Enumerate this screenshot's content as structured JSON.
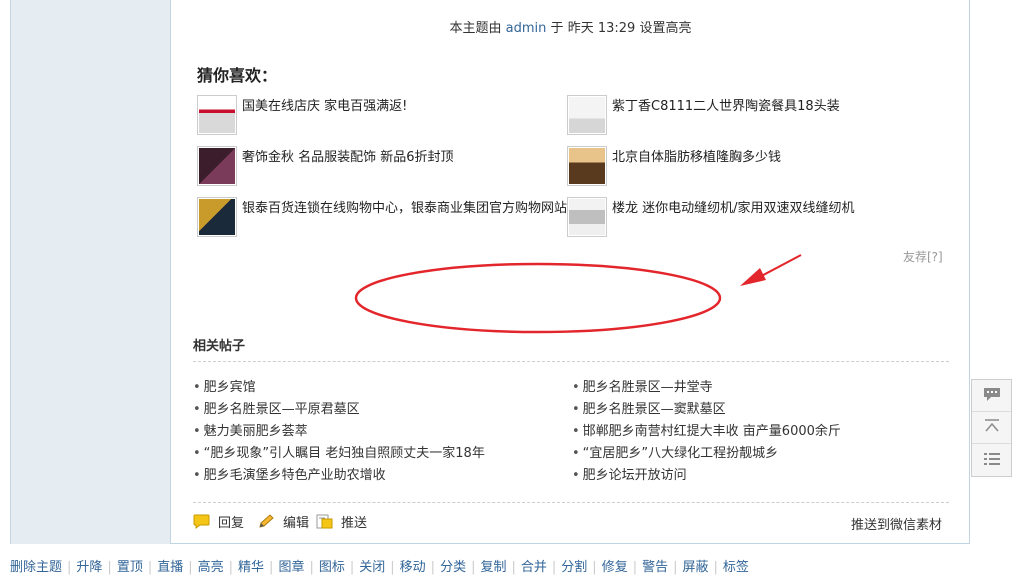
{
  "highlight_note": {
    "prefix": "本主题由",
    "user": "admin",
    "middle": "于",
    "time": "昨天 13:29",
    "suffix": "设置高亮"
  },
  "recommend": {
    "title": "猜你喜欢：",
    "items": [
      {
        "title": "国美在线店庆 家电百强满返!"
      },
      {
        "title": "紫丁香C8111二人世界陶瓷餐具18头装"
      },
      {
        "title": "奢饰金秋 名品服装配饰 新品6折封顶"
      },
      {
        "title": "北京自体脂肪移植隆胸多少钱"
      },
      {
        "title": "银泰百货连锁在线购物中心，银泰商业集团官方购物网站"
      },
      {
        "title": "楼龙 迷你电动缝纫机/家用双速双线缝纫机"
      }
    ],
    "youjian": "友荐[?]"
  },
  "related": {
    "title": "相关帖子",
    "left": [
      "肥乡宾馆",
      "肥乡名胜景区—平原君墓区",
      "魅力美丽肥乡荟萃",
      "“肥乡现象”引人瞩目 老妇独自照顾丈夫一家18年",
      "肥乡毛演堡乡特色产业助农增收"
    ],
    "right": [
      "肥乡名胜景区—井堂寺",
      "肥乡名胜景区—窦默墓区",
      "邯郸肥乡南营村红提大丰收 亩产量6000余斤",
      "“宜居肥乡”八大绿化工程扮靓城乡",
      "肥乡论坛开放访问"
    ]
  },
  "actions": {
    "reply": "回复",
    "edit": "编辑",
    "push": "推送",
    "wechat": "推送到微信素材"
  },
  "mod_bar": [
    "删除主题",
    "升降",
    "置顶",
    "直播",
    "高亮",
    "精华",
    "图章",
    "图标",
    "关闭",
    "移动",
    "分类",
    "复制",
    "合并",
    "分割",
    "修复",
    "警告",
    "屏蔽",
    "标签"
  ],
  "colors": {
    "link": "#336699",
    "annotation": "#e3262b",
    "sidebar_bg": "#e5edf2"
  }
}
